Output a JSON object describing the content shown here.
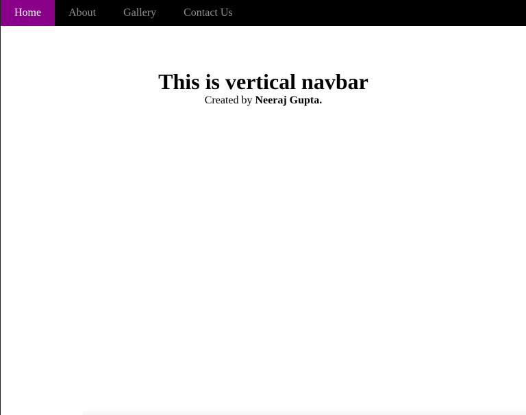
{
  "nav": {
    "items": [
      {
        "label": "Home",
        "active": true
      },
      {
        "label": "About",
        "active": false
      },
      {
        "label": "Gallery",
        "active": false
      },
      {
        "label": "Contact Us",
        "active": false
      }
    ],
    "background_color": "#000000",
    "active_color": "#8b008b",
    "text_color": "#8f8f8f",
    "active_text_color": "#ffffff"
  },
  "hero": {
    "title": "This is vertical navbar",
    "credit_prefix": "Created by ",
    "credit_author": "Neeraj Gupta."
  }
}
